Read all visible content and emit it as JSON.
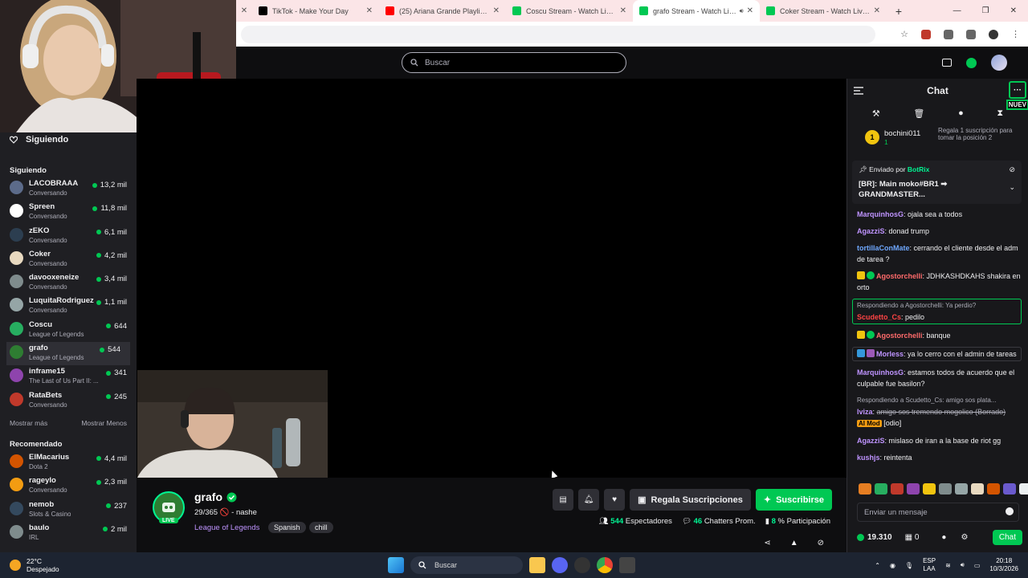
{
  "browser": {
    "tabs": [
      {
        "label": "TikTok - Make Your Day",
        "color": "#000000"
      },
      {
        "label": "(25) Ariana Grande Playlist Mix",
        "color": "#ff0000"
      },
      {
        "label": "Coscu Stream - Watch Live on Kick",
        "color": "#00c853"
      },
      {
        "label": "grafo Stream - Watch Live on Kick",
        "color": "#00c853",
        "active": true
      },
      {
        "label": "Coker Stream - Watch Live on Kick",
        "color": "#00c853"
      }
    ],
    "new_tab": "+"
  },
  "header": {
    "search_placeholder": "Buscar"
  },
  "sidebar": {
    "following_label": "Siguiendo",
    "section_following": "Siguiendo",
    "following": [
      {
        "name": "LACOBRAAA",
        "game": "Conversando",
        "viewers": "13,2 mil",
        "color": "#5c6b8a"
      },
      {
        "name": "Spreen",
        "game": "Conversando",
        "viewers": "11,8 mil",
        "color": "#ffffff"
      },
      {
        "name": "zEKO",
        "game": "Conversando",
        "viewers": "6,1 mil",
        "color": "#2c3e50"
      },
      {
        "name": "Coker",
        "game": "Conversando",
        "viewers": "4,2 mil",
        "color": "#e8d9c0"
      },
      {
        "name": "davooxeneize",
        "game": "Conversando",
        "viewers": "3,4 mil",
        "color": "#7f8c8d"
      },
      {
        "name": "LuquitaRodriguez",
        "game": "Conversando",
        "viewers": "1,1 mil",
        "color": "#95a5a6"
      },
      {
        "name": "Coscu",
        "game": "League of Legends",
        "viewers": "644",
        "color": "#27ae60"
      },
      {
        "name": "grafo",
        "game": "League of Legends",
        "viewers": "544",
        "color": "#2e7d32",
        "selected": true
      },
      {
        "name": "inframe15",
        "game": "The Last of Us Part II: ...",
        "viewers": "341",
        "color": "#8e44ad"
      },
      {
        "name": "RataBets",
        "game": "Conversando",
        "viewers": "245",
        "color": "#c0392b"
      }
    ],
    "show_more": "Mostrar más",
    "show_less": "Mostrar Menos",
    "section_recommended": "Recomendado",
    "recommended": [
      {
        "name": "ElMacarius",
        "game": "Dota 2",
        "viewers": "4,4 mil",
        "color": "#d35400"
      },
      {
        "name": "rageylo",
        "game": "Conversando",
        "viewers": "2,3 mil",
        "color": "#f39c12"
      },
      {
        "name": "nemob",
        "game": "Slots & Casino",
        "viewers": "237",
        "color": "#34495e"
      },
      {
        "name": "baulo",
        "game": "IRL",
        "viewers": "2 mil",
        "color": "#7f8c8d"
      }
    ]
  },
  "channel": {
    "name": "grafo",
    "live": "LIVE",
    "title": "29/365 🚫 - nashe",
    "game": "League of Legends",
    "tags": [
      "Spanish",
      "chill"
    ],
    "gift_button": "Regala Suscripciones",
    "subscribe_button": "Suscribirse",
    "viewers_value": "544",
    "viewers_label": "Espectadores",
    "chatters_value": "46",
    "chatters_label": "Chatters Prom.",
    "participation_value": "8",
    "participation_label": "% Participación"
  },
  "chat": {
    "title": "Chat",
    "menu": "···",
    "new_label": "NUEV",
    "leader": {
      "name": "bochini011",
      "rank": "1",
      "count": "1",
      "gift_text": "Regala 1 suscripción para tomar la posición 2"
    },
    "pinned": {
      "header_prefix": "Enviado por",
      "author": "BotRix",
      "text": "[BR]: Main moko#BR1 ➡ GRANDMASTER..."
    },
    "messages": [
      {
        "user": "MarquinhosG",
        "color": "#bf94ff",
        "text": "ojala sea a todos"
      },
      {
        "user": "AgazziS",
        "color": "#bf94ff",
        "text": "donad trump"
      },
      {
        "user": "tortillaConMate",
        "color": "#6fa8ff",
        "text": "cerrando el cliente desde el adm de tarea ?"
      },
      {
        "user": "Agostorchelli",
        "color": "#ff6b6b",
        "text": "JDHKASHDKAHS shakira en orto",
        "badges": true
      },
      {
        "reply": "Respondiendo a Agostorchelli: Ya perdio?",
        "user": "Scudetto_Cs",
        "color": "#ff4444",
        "text": "pedilo",
        "hl": true
      },
      {
        "user": "Agostorchelli",
        "color": "#ff6b6b",
        "text": "banque",
        "badges": true
      },
      {
        "user": "Morless",
        "color": "#bf94ff",
        "text": "ya lo cerro con el admin de tareas",
        "hl2": true
      },
      {
        "user": "MarquinhosG",
        "color": "#bf94ff",
        "text": "estamos todos de acuerdo que el culpable fue basilon?"
      },
      {
        "reply": "Respondiendo a Scudetto_Cs: amigo sos plata...",
        "user": "lviza",
        "color": "#bf94ff",
        "text": "amigo sos tremendo mogolico (Borrado)",
        "deleted": true,
        "mod_label": "AI Mod",
        "mod_text": "[odio]"
      },
      {
        "user": "AgazziS",
        "color": "#bf94ff",
        "text": "mislaso de iran a la base de riot gg"
      },
      {
        "user": "kushjs",
        "color": "#bf94ff",
        "text": "reintenta"
      }
    ],
    "input_placeholder": "Enviar un mensaje",
    "points": "19.310",
    "bag_count": "0",
    "send_button": "Chat"
  },
  "taskbar": {
    "weather_temp": "22°C",
    "weather_desc": "Despejado",
    "search_placeholder": "Buscar",
    "lang_top": "ESP",
    "lang_bottom": "LAA",
    "time": "20:18",
    "date": "10/3/2026"
  }
}
